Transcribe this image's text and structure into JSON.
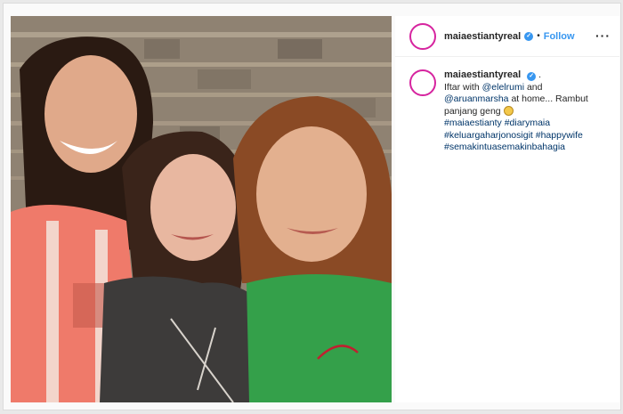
{
  "post": {
    "username": "maiaestiantyreal",
    "verified_symbol": "✓",
    "separator": "•",
    "follow_label": "Follow",
    "more_label": "···"
  },
  "caption": {
    "username": "maiaestiantyreal",
    "after_name": ".",
    "text_1": "Iftar with ",
    "mention_1": "@elelrumi",
    "text_2": " and ",
    "mention_2": "@aruanmarsha",
    "text_3": " at home... Rambut panjang geng ",
    "hashtags": [
      "#maiaestianty",
      "#diarymaia",
      "#keluargaharjonosigit",
      "#happywife",
      "#semakintuasemakinbahagia"
    ]
  },
  "colors": {
    "accent": "#3897f0",
    "link": "#003569",
    "ring": "#d6249f"
  },
  "icons": {
    "verified": "verified-badge-icon",
    "more": "more-options-icon",
    "emoji": "grinning-sweat-emoji-icon"
  }
}
